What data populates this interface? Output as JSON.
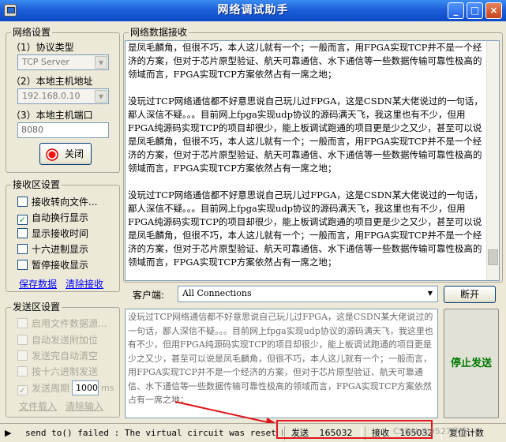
{
  "window": {
    "title": "网络调试助手"
  },
  "net_settings": {
    "group_label": "网络设置",
    "protocol_label": "（1）协议类型",
    "protocol_value": "TCP Server",
    "host_ip_label": "（2）本地主机地址",
    "host_ip_value": "192.168.0.10",
    "host_port_label": "（3）本地主机端口",
    "host_port_value": "8080",
    "connect_button_label": "关闭"
  },
  "recv_settings": {
    "group_label": "接收区设置",
    "options": [
      {
        "label": "接收转向文件...",
        "checked": false
      },
      {
        "label": "自动换行显示",
        "checked": true
      },
      {
        "label": "显示接收时间",
        "checked": false
      },
      {
        "label": "十六进制显示",
        "checked": false
      },
      {
        "label": "暂停接收显示",
        "checked": false
      }
    ],
    "save_link": "保存数据",
    "clear_link": "清除接收"
  },
  "send_settings": {
    "group_label": "发送区设置",
    "options": [
      {
        "label": "启用文件数据源...",
        "checked": false
      },
      {
        "label": "自动发送附加位",
        "checked": false
      },
      {
        "label": "发送完自动清空",
        "checked": false
      },
      {
        "label": "按十六进制发送",
        "checked": false
      },
      {
        "label": "发送周期",
        "checked": true
      }
    ],
    "period_value": "1000",
    "period_unit": "ms",
    "file_load_link": "文件载入",
    "clear_input_link": "清除输入"
  },
  "receive_area": {
    "group_label": "网络数据接收",
    "paragraphs": [
      "是凤毛麟角，但很不巧，本人这儿就有一个；一般而言，用FPGA实现TCP并不是一个经济的方案，但对于芯片原型验证、航天可靠通信、水下通信等一些数据传输可靠性极高的领域而言，FPGA实现TCP方案依然占有一席之地；",
      "没玩过TCP网络通信都不好意思说自己玩儿过FPGA，这是CSDN某大佬说过的一句话，鄙人深信不疑。。。目前网上fpga实现udp协议的源码满天飞，我这里也有不少，但用FPGA纯源码实现TCP的项目却很少，能上板调试跑通的项目更是少之又少，甚至可以说是凤毛麟角，但很不巧，本人这儿就有一个；一般而言，用FPGA实现TCP并不是一个经济的方案，但对于芯片原型验证、航天可靠通信、水下通信等一些数据传输可靠性极高的领域而言，FPGA实现TCP方案依然占有一席之地；",
      "没玩过TCP网络通信都不好意思说自己玩儿过FPGA，这是CSDN某大佬说过的一句话，鄙人深信不疑。。。目前网上fpga实现udp协议的源码满天飞，我这里也有不少，但用FPGA纯源码实现TCP的项目却很少，能上板调试跑通的项目更是少之又少，甚至可以说是凤毛麟角，但很不巧，本人这儿就有一个；一般而言，用FPGA实现TCP并不是一个经济的方案，但对于芯片原型验证、航天可靠通信、水下通信等一些数据传输可靠性极高的领域而言，FPGA实现TCP方案依然占有一席之地；"
    ]
  },
  "client_bar": {
    "label": "客户端:",
    "value": "All Connections",
    "disconnect_button": "断开"
  },
  "send_area": {
    "text": "没玩过TCP网络通信都不好意思说自己玩儿过FPGA，这是CSDN某大佬说过的一句话，鄙人深信不疑。。。目前网上fpga实现udp协议的源码满天飞，我这里也有不少，但用FPGA纯源码实现TCP的项目却很少，能上板调试跑通的项目更是少之又少，甚至可以说是凤毛麟角，但很不巧，本人这儿就有一个；一般而言，用FPGA实现TCP并不是一个经济的方案，但对于芯片原型验证、航天可靠通信、水下通信等一些数据传输可靠性极高的领域而言，FPGA实现TCP方案依然占有一席之地；",
    "send_button": "停止发送"
  },
  "status_bar": {
    "message": "send to() failed : The virtual circuit was reset by the",
    "sent_label": "发送",
    "sent_count": "165032",
    "recv_label": "接收",
    "recv_count": "165032",
    "reset_button": "复位计数",
    "watermark": "CSDN @9527华安"
  },
  "colors": {
    "title_bar": "#1d5fd8",
    "highlight_box": "#e0141a",
    "arrow": "#e0141a",
    "send_button_text": "#007a00",
    "link": "#0000ff"
  }
}
